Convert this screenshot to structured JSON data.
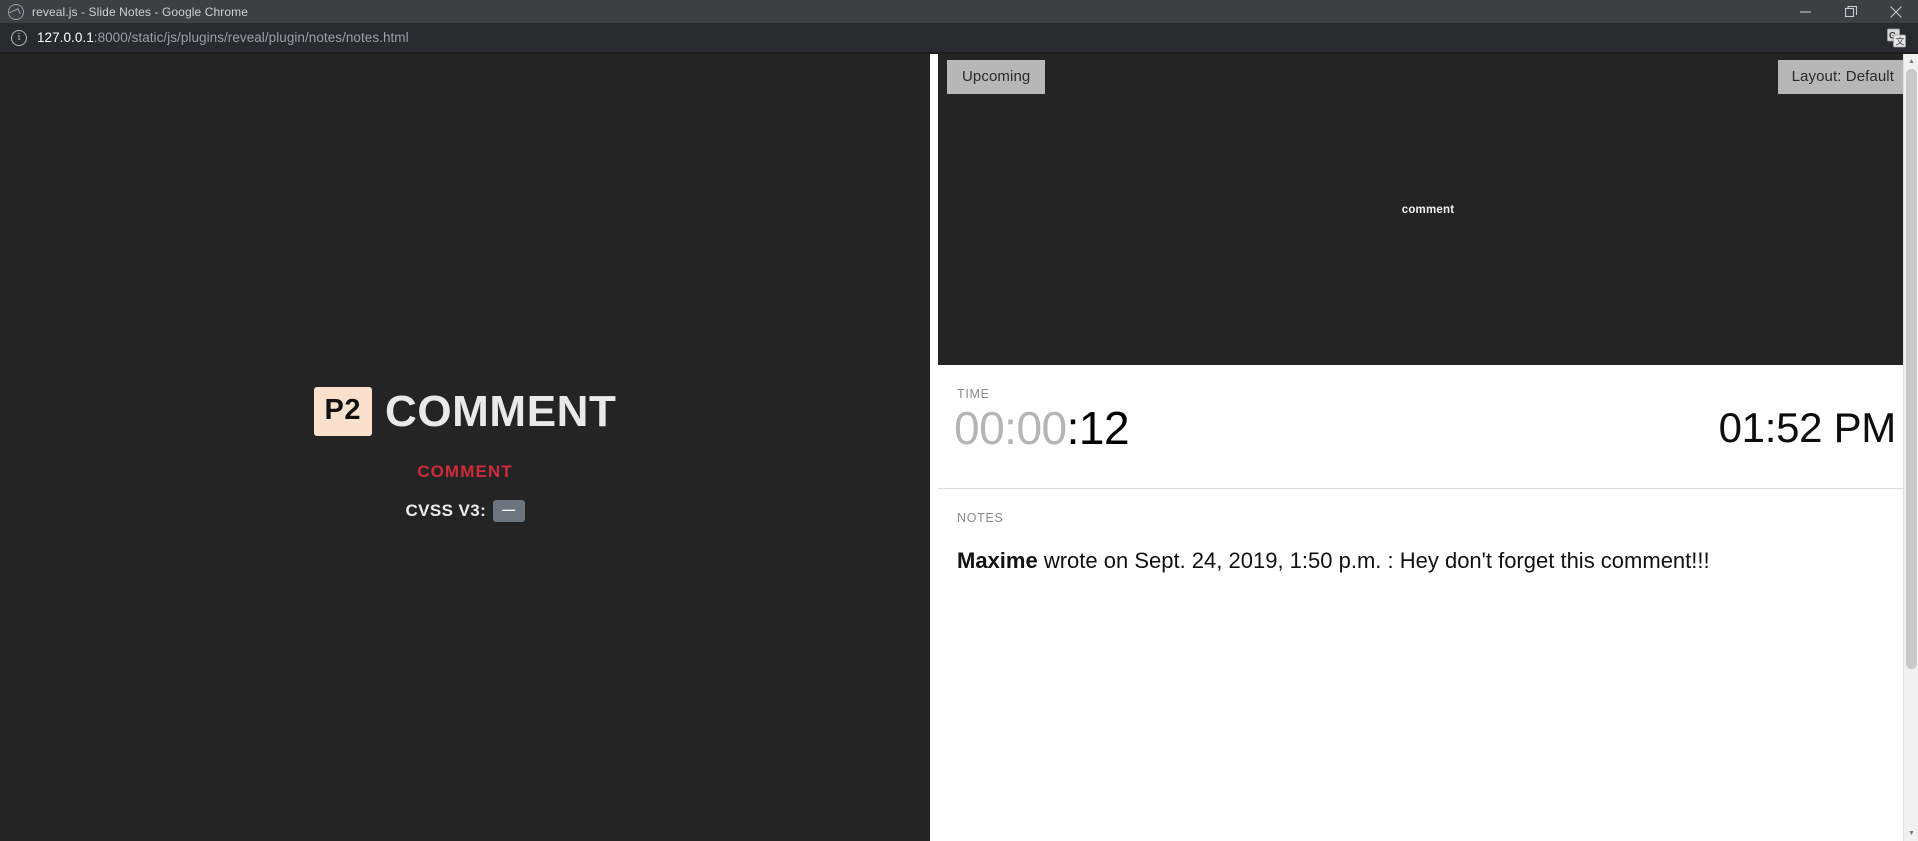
{
  "window": {
    "title": "reveal.js - Slide Notes - Google Chrome",
    "favicon": "reveal-logo-icon",
    "controls": {
      "minimize": "minimize-icon",
      "maximize": "maximize-icon",
      "close": "close-icon"
    }
  },
  "addressbar": {
    "info_icon": "site-info-icon",
    "url_host": "127.0.0.1",
    "url_path": ":8000/static/js/plugins/reveal/plugin/notes/notes.html",
    "translate_icon": "translate-icon"
  },
  "current_slide": {
    "badge": "P2",
    "title": "COMMENT",
    "subtitle": "COMMENT",
    "cvss_label": "CVSS V3:",
    "cvss_value": "—",
    "background": "#242424",
    "badge_color": "#fbe0cd",
    "subtitle_color": "#cf2b3c"
  },
  "upcoming": {
    "toggle_label": "Upcoming",
    "layout_label": "Layout: Default",
    "preview_text": "comment"
  },
  "time": {
    "label": "TIME",
    "elapsed_dim": "00:00",
    "elapsed_hot": ":12",
    "clock": "01:52 PM"
  },
  "notes": {
    "label": "NOTES",
    "author": "Maxime",
    "text": " wrote on Sept. 24, 2019, 1:50 p.m. : Hey don't forget this comment!!!"
  },
  "scrollbar": {
    "up_arrow": "scroll-up-icon",
    "down_arrow": "scroll-down-icon"
  }
}
